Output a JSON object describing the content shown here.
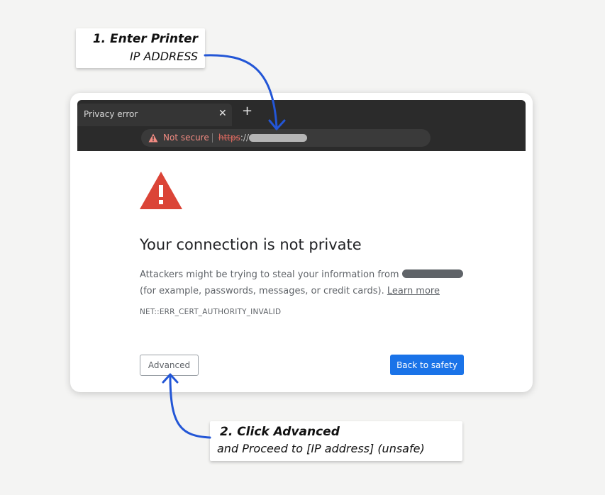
{
  "browser": {
    "tab_title": "Privacy error",
    "tab_close_glyph": "✕",
    "new_tab_glyph": "+",
    "security_label": "Not secure",
    "url_scheme": "https",
    "url_separator": "://"
  },
  "error_page": {
    "headline": "Your connection is not private",
    "body_before": "Attackers might be trying to steal your information from ",
    "body_after": " (for example, passwords, messages, or credit cards). ",
    "learn_more": "Learn more",
    "error_code": "NET::ERR_CERT_AUTHORITY_INVALID",
    "advanced_label": "Advanced",
    "back_label": "Back to safety"
  },
  "callouts": {
    "step1_title": "1. Enter Printer",
    "step1_sub": "IP ADDRESS",
    "step2_title": "2. Click Advanced",
    "step2_sub": "and Proceed to [IP address] (unsafe)"
  },
  "colors": {
    "background": "#f4f4f3",
    "chrome_dark": "#2b2b2b",
    "warning_red": "#db4437",
    "not_secure": "#f28b82",
    "primary_blue": "#1a73e8",
    "arrow_blue": "#2356d6",
    "text_dark": "#202124",
    "text_muted": "#5f6368"
  },
  "icons": {
    "omnibox_warning": "warning-triangle-icon",
    "page_warning": "warning-triangle-icon",
    "close_tab": "close-icon",
    "new_tab": "plus-icon"
  }
}
